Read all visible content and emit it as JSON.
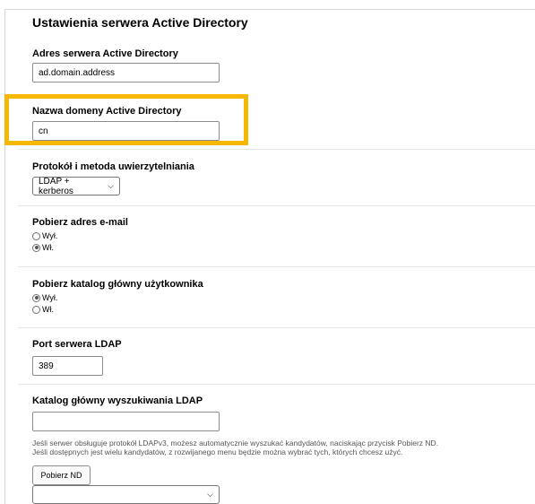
{
  "page": {
    "title": "Ustawienia serwera Active Directory"
  },
  "server_address": {
    "label": "Adres serwera Active Directory",
    "value": "ad.domain.address"
  },
  "domain_name": {
    "label": "Nazwa domeny Active Directory",
    "value": "cn"
  },
  "auth": {
    "label": "Protokół i metoda uwierzytelniania",
    "selected": "LDAP + kerberos"
  },
  "get_email": {
    "label": "Pobierz adres e-mail",
    "options": [
      {
        "label": "Wył.",
        "checked": false
      },
      {
        "label": "Wł.",
        "checked": true
      }
    ]
  },
  "get_home_dir": {
    "label": "Pobierz katalog główny użytkownika",
    "options": [
      {
        "label": "Wył.",
        "checked": true
      },
      {
        "label": "Wł.",
        "checked": false
      }
    ]
  },
  "ldap_port": {
    "label": "Port serwera LDAP",
    "value": "389"
  },
  "ldap_search_root": {
    "label": "Katalog główny wyszukiwania LDAP",
    "value": "",
    "help_line1": "Jeśli serwer obsługuje protokół LDAPv3, możesz automatycznie wyszukać kandydatów, naciskając przycisk Pobierz ND.",
    "help_line2": "Jeśli dostępnych jest wielu kandydatów, z rozwijanego menu będzie można wybrać tych, których chcesz użyć.",
    "fetch_button": "Pobierz ND",
    "candidates_selected": ""
  },
  "colors": {
    "highlight": "#f6b700"
  }
}
